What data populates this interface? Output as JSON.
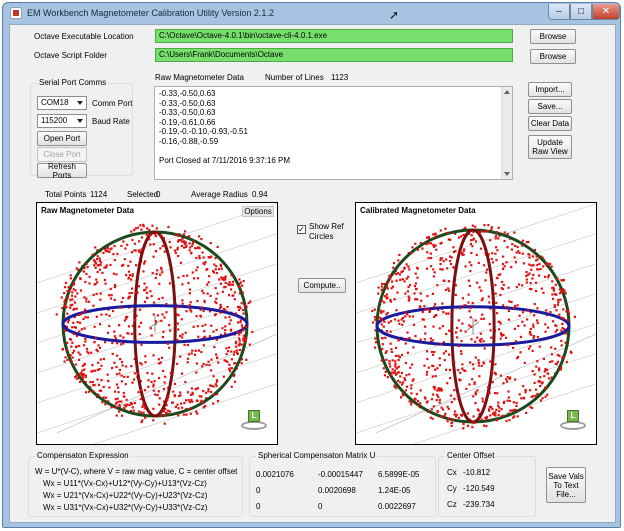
{
  "window": {
    "title": "EM Workbench Magnetometer Calibration Utility Version 2.1.2"
  },
  "paths": {
    "octave_exe_label": "Octave Executable Location",
    "octave_exe_value": "C:\\Octave\\Octave-4.0.1\\bin\\octave-cli-4.0.1.exe",
    "octave_script_label": "Octave Script Folder",
    "octave_script_value": "C:\\Users\\Frank\\Documents\\Octave",
    "browse_label": "Browse"
  },
  "serial": {
    "title": "Serial Port Comms",
    "com_port_value": "COM18",
    "com_port_label": "Comm Port",
    "baud_value": "115200",
    "baud_label": "Baud Rate",
    "open_port": "Open Port",
    "close_port": "Close Port",
    "refresh_ports": "Refresh Ports"
  },
  "raw_data": {
    "label": "Raw Magnetometer Data",
    "lines_label": "Number of Lines",
    "lines_value": "1123",
    "lines": [
      "-0.33,-0.50,0.63",
      "-0.33,-0.50,0.63",
      "-0.33,-0.50,0.63",
      "-0.19,-0.61,0.66",
      "-0.19,-0.-0.10,-0.93,-0.51",
      "-0.16,-0.88,-0.59",
      "",
      "Port Closed at 7/11/2016 9:37:16 PM"
    ]
  },
  "side_buttons": {
    "import": "Import...",
    "save": "Save...",
    "clear": "Clear Data",
    "update_line1": "Update",
    "update_line2": "Raw View"
  },
  "stats": {
    "total_label": "Total Points",
    "total_value": "1124",
    "selected_label": "Selected",
    "selected_value": "0",
    "avg_label": "Average Radius",
    "avg_value": "0.94"
  },
  "plots": {
    "raw_title": "Raw Magnetometer Data",
    "options": "Options",
    "cal_title": "Calibrated Magnetometer Data",
    "show_ref_line1": "Show Ref",
    "show_ref_line2": "Circles",
    "show_ref_checked": true,
    "compute": "Compute..",
    "cube_letter": "L"
  },
  "compensation": {
    "title": "Compensaton Expression",
    "line0": "W = U*(V-C), where V = raw mag value, C = center offset",
    "line1": "Wx = U11*(Vx-Cx)+U12*(Vy-Cy)+U13*(Vz-Cz)",
    "line2": "Wx = U21*(Vx-Cx)+U22*(Vy-Cy)+U23*(Vz-Cz)",
    "line3": "Wx = U31*(Vx-Cx)+U32*(Vy-Cy)+U33*(Vz-Cz)"
  },
  "matrix": {
    "title": "Spherical Compensaton Matrix U",
    "rows": [
      [
        "0.0021076",
        "-0.00015447",
        "6.5899E-05"
      ],
      [
        "0",
        "0.0020698",
        "1.24E-05"
      ],
      [
        "0",
        "0",
        "0.0022697"
      ]
    ]
  },
  "offset": {
    "title": "Center Offset",
    "cx_label": "Cx",
    "cx_value": "-10.812",
    "cy_label": "Cy",
    "cy_value": "-120.549",
    "cz_label": "Cz",
    "cz_value": "-239.734"
  },
  "save_vals": {
    "line1": "Save Vals",
    "line2": "To Text",
    "line3": "File..."
  },
  "colors": {
    "sphere_outline": "#1c4a1c",
    "meridian": "#7a1010",
    "equator": "#1a1aa0",
    "points": "#e01010",
    "path_bg": "#77e06c"
  }
}
